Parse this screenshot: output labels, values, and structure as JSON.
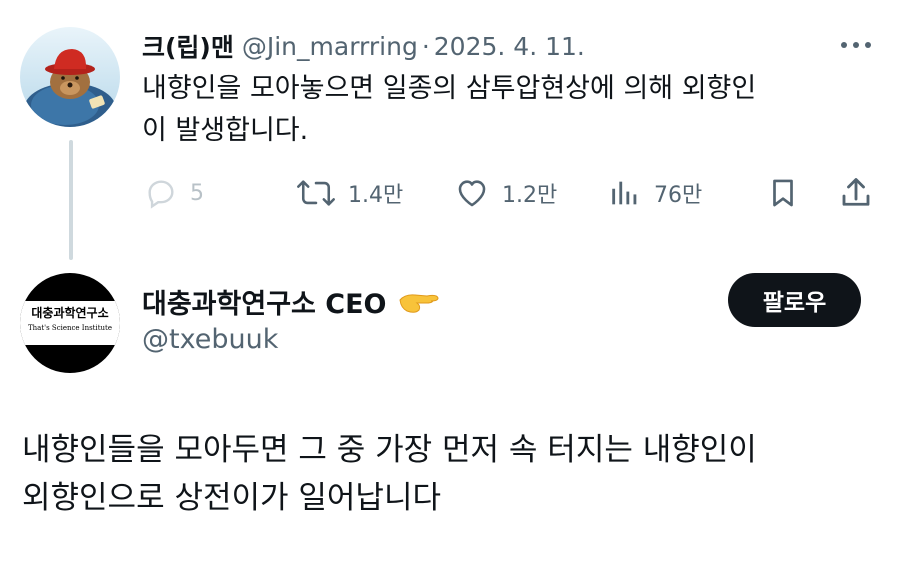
{
  "parent_tweet": {
    "display_name": "크(립)맨",
    "handle": "@Jin_marrring",
    "separator": "·",
    "date": "2025. 4. 11.",
    "text_line1": "내향인을 모아놓으면 일종의 삼투압현상에 의해 외향인",
    "text_line2": "이 발생합니다.",
    "avatar_icon": "bear-with-red-hat-avatar",
    "more_icon": "more-horizontal-icon",
    "actions": {
      "replies": "5",
      "retweets": "1.4만",
      "likes": "1.2만",
      "views": "76만"
    }
  },
  "quoted_tweet": {
    "display_name": "대충과학연구소 CEO",
    "emoji": "pinching-hand-emoji",
    "handle": "@txebuuk",
    "follow_label": "팔로우",
    "avatar_title": "대충과학연구소",
    "avatar_subtitle": "That's Science Institute",
    "text_line1": "내향인들을 모아두면 그 중 가장 먼저 속 터지는 내향인이",
    "text_line2": "외향인으로 상전이가 일어납니다"
  },
  "colors": {
    "text_primary": "#0f1419",
    "text_secondary": "#536471",
    "thread_line": "#cfd9de",
    "follow_button_bg": "#0f1419",
    "follow_button_text": "#ffffff"
  }
}
